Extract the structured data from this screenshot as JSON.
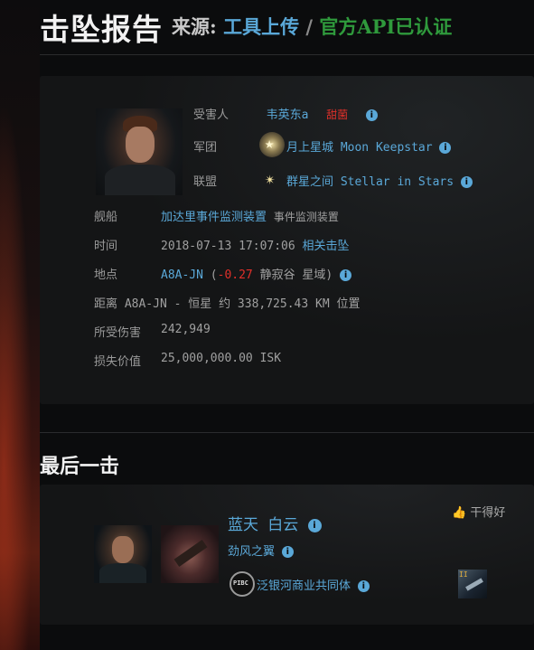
{
  "header": {
    "title": "击坠报告",
    "source_label": "来源:",
    "source_tool": "工具上传",
    "separator": "/",
    "source_api": "官方API已认证"
  },
  "victim": {
    "victim_label": "受害人",
    "victim_name": "韦英东a",
    "victim_tag": "甜菌",
    "corp_label": "军团",
    "corp_name": "月上星城 Moon Keepstar",
    "alliance_label": "联盟",
    "alliance_name": "群星之间 Stellar in Stars",
    "ship_label": "舰船",
    "ship_name": "加达里事件监测装置",
    "ship_class": "事件监测装置",
    "time_label": "时间",
    "time_value": "2018-07-13 17:07:06",
    "related_link": "相关击坠",
    "location_label": "地点",
    "system_name": "A8A-JN",
    "security_open": "(",
    "security_value": "-0.27",
    "region": "静寂谷 星域)",
    "distance_text": "距离 A8A-JN - 恒星 约 338,725.43 KM 位置",
    "damage_label": "所受伤害",
    "damage_value": "242,949",
    "loss_label": "损失价值",
    "loss_value": "25,000,000.00 ISK"
  },
  "final_blow": {
    "section_title": "最后一击",
    "pilot_name": "蓝天 白云",
    "corp_name": "劲风之翼",
    "alliance_name": "泛银河商业共同体",
    "like_label": "干得好",
    "weapon_tag": "II",
    "alliance_logo_text": "PIBC"
  },
  "icons": {
    "info": "info-icon",
    "thumbs_up": "thumbs-up-icon",
    "corp_logo": "star-emblem-icon",
    "alliance_logo": "starburst-icon"
  },
  "colors": {
    "link": "#5aa8d8",
    "verified": "#2f9a3c",
    "negative_sec": "#e0302a",
    "victim_tag": "#e0302a"
  }
}
